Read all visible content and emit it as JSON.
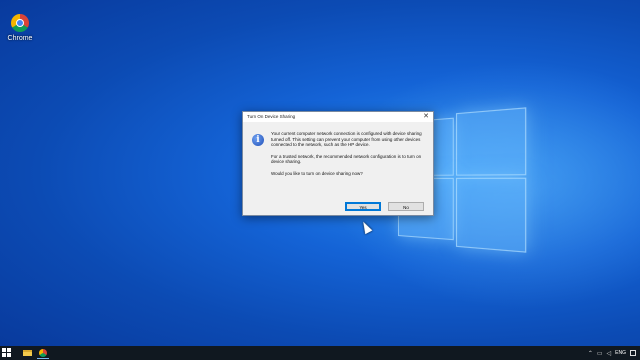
{
  "desktop": {
    "icons": [
      {
        "label": "Chrome",
        "icon": "chrome-icon"
      }
    ]
  },
  "dialog": {
    "title": "Turn On Device Sharing",
    "close_glyph": "✕",
    "icon": "info-icon",
    "info_glyph": "i",
    "paragraphs": [
      "Your current computer network connection is configured with device sharing turned off. This setting can prevent your computer from using other devices connected to the network, such as the HP device.",
      "For a trusted network, the recommended network configuration is to turn on device sharing.",
      "Would you like to turn on device sharing now?"
    ],
    "yes_label": "Yes",
    "no_label": "No"
  },
  "taskbar": {
    "apps": [
      "file-explorer-icon",
      "chrome-icon"
    ],
    "tray": {
      "language": "ENG"
    }
  }
}
